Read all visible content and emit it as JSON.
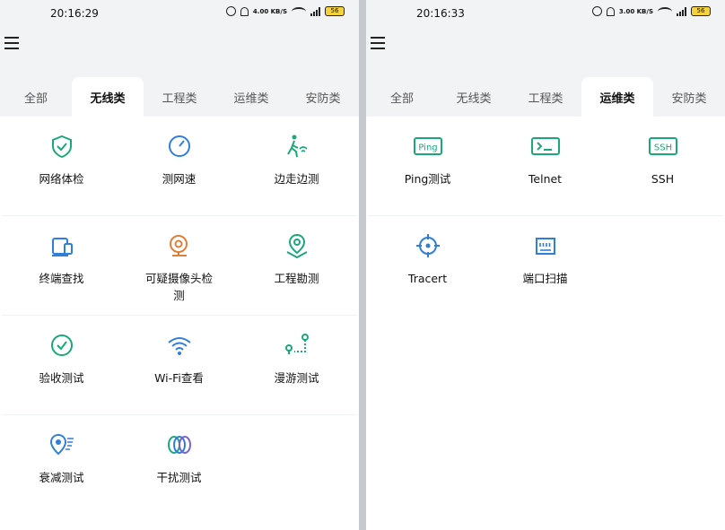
{
  "screens": [
    {
      "status": {
        "time": "20:16:29",
        "speed": "4.00 KB/S",
        "battery": "56"
      },
      "tabs": [
        "全部",
        "无线类",
        "工程类",
        "运维类",
        "安防类"
      ],
      "active_tab": 1,
      "tools": [
        {
          "label": "网络体检",
          "icon": "shield-check-icon"
        },
        {
          "label": "测网速",
          "icon": "speedometer-icon"
        },
        {
          "label": "边走边测",
          "icon": "walking-wifi-icon"
        },
        {
          "label": "终端查找",
          "icon": "devices-icon"
        },
        {
          "label": "可疑摄像头检测",
          "icon": "camera-icon"
        },
        {
          "label": "工程勘测",
          "icon": "map-pin-icon"
        },
        {
          "label": "验收测试",
          "icon": "check-circle-icon"
        },
        {
          "label": "Wi-Fi查看",
          "icon": "wifi-icon"
        },
        {
          "label": "漫游测试",
          "icon": "roaming-icon"
        },
        {
          "label": "衰减测试",
          "icon": "attenuation-icon"
        },
        {
          "label": "干扰测试",
          "icon": "interference-icon"
        }
      ]
    },
    {
      "status": {
        "time": "20:16:33",
        "speed": "3.00 KB/S",
        "battery": "56"
      },
      "tabs": [
        "全部",
        "无线类",
        "工程类",
        "运维类",
        "安防类"
      ],
      "active_tab": 3,
      "tools": [
        {
          "label": "Ping测试",
          "icon": "ping-icon",
          "badge": "Ping"
        },
        {
          "label": "Telnet",
          "icon": "terminal-icon"
        },
        {
          "label": "SSH",
          "icon": "ssh-icon",
          "badge": "SSH"
        },
        {
          "label": "Tracert",
          "icon": "crosshair-icon"
        },
        {
          "label": "端口扫描",
          "icon": "port-icon"
        }
      ]
    }
  ],
  "colors": {
    "accent": "#1aa87a",
    "blue": "#2f7fd8",
    "orange": "#e07f3a",
    "purple": "#7b61c9",
    "tab_bg": "#f2f3f5"
  }
}
